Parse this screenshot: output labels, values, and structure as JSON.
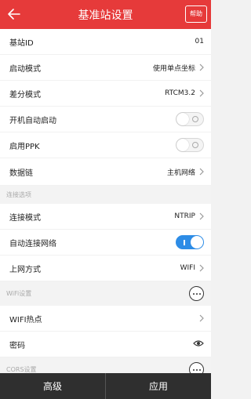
{
  "header": {
    "title": "基准站设置",
    "help_label": "帮助",
    "back_icon": "back-arrow-icon",
    "background_color": "#e63a3a"
  },
  "rows": {
    "station_id": {
      "label": "基站ID",
      "value": "01"
    },
    "start_mode": {
      "label": "启动模式",
      "value": "使用单点坐标"
    },
    "diff_mode": {
      "label": "差分模式",
      "value": "RTCM3.2"
    },
    "auto_start": {
      "label": "开机自动启动",
      "toggle": false
    },
    "enable_ppk": {
      "label": "启用PPK",
      "toggle": false
    },
    "data_link": {
      "label": "数据链",
      "value": "主机网络"
    }
  },
  "connection_section": {
    "title": "连接选项",
    "mode": {
      "label": "连接模式",
      "value": "NTRIP"
    },
    "auto_connect": {
      "label": "自动连接网络",
      "toggle": true
    },
    "internet_method": {
      "label": "上网方式",
      "value": "WIFI"
    }
  },
  "wifi_section": {
    "title": "WiFi设置",
    "hotspot": {
      "label": "WIFI热点",
      "value": ""
    },
    "password": {
      "label": "密码",
      "icon": "eye-icon"
    }
  },
  "cors_section": {
    "title": "CORS设置"
  },
  "footer": {
    "advanced_label": "高级",
    "apply_label": "应用"
  },
  "colors": {
    "accent": "#e63a3a",
    "toggle_on": "#2d8ce6",
    "footer_bg": "#2f2f2f"
  }
}
